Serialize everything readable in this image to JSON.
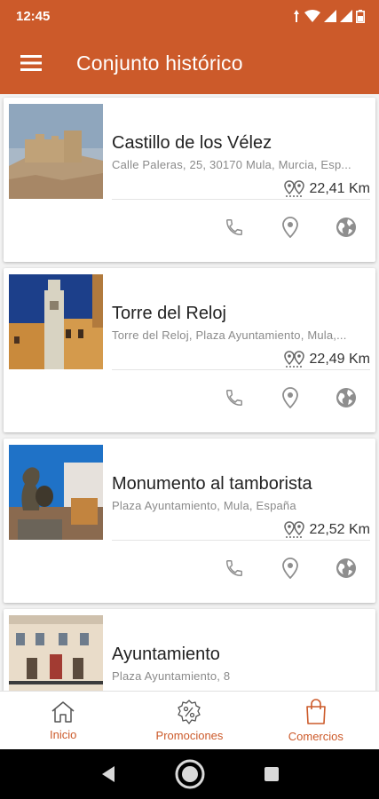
{
  "status_bar": {
    "time": "12:45"
  },
  "app_bar": {
    "title": "Conjunto histórico"
  },
  "items": [
    {
      "title": "Castillo de los Vélez",
      "address": "Calle Paleras, 25, 30170 Mula, Murcia, Esp...",
      "distance": "22,41 Km"
    },
    {
      "title": "Torre del Reloj",
      "address": "Torre del Reloj, Plaza Ayuntamiento, Mula,...",
      "distance": "22,49 Km"
    },
    {
      "title": "Monumento al tamborista",
      "address": "Plaza Ayuntamiento, Mula, España",
      "distance": "22,52 Km"
    },
    {
      "title": "Ayuntamiento",
      "address": "Plaza Ayuntamiento, 8",
      "distance": ""
    }
  ],
  "bottom_nav": {
    "inicio": "Inicio",
    "promociones": "Promociones",
    "comercios": "Comercios"
  },
  "colors": {
    "primary": "#cc5a2a",
    "icon_gray": "#8e8e8e"
  }
}
